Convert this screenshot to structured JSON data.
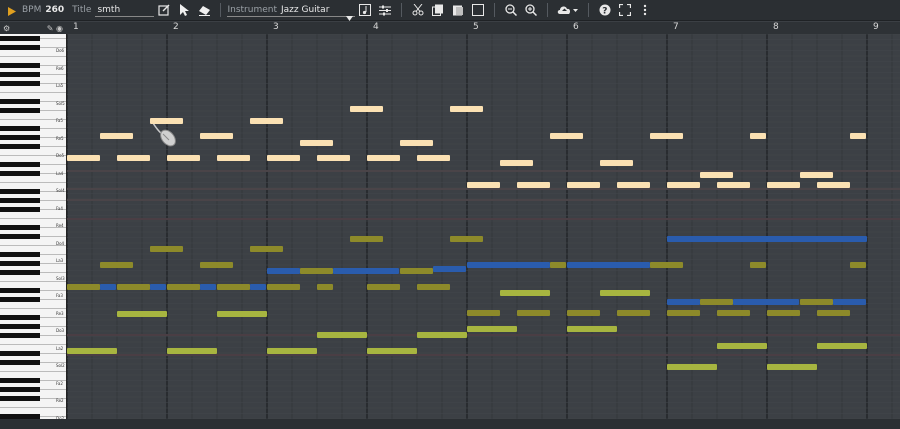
{
  "toolbar": {
    "bpm_label": "BPM",
    "bpm_value": "260",
    "title_label": "Title",
    "title_value": "smth",
    "instrument_label": "Instrument",
    "instrument_value": "Jazz Guitar",
    "icons": [
      "play-icon",
      "edit-icon",
      "pointer-icon",
      "eraser-icon",
      "dropdown-arrow-icon",
      "music-note-icon",
      "sliders-icon",
      "cut-icon",
      "copy-icon",
      "paste-icon",
      "square-icon",
      "zoom-out-icon",
      "zoom-in-icon",
      "upload-icon",
      "help-icon",
      "fullscreen-icon",
      "more-icon"
    ]
  },
  "bars": [
    "1",
    "2",
    "3",
    "4",
    "5",
    "6",
    "7",
    "8",
    "9"
  ],
  "keyboard_labels": [
    "Do6",
    "Re6",
    "La5",
    "Sol5",
    "Fa5",
    "Re5",
    "Do5",
    "La4",
    "Sol4",
    "Fa4",
    "Re4",
    "Do4",
    "La3",
    "Sol3",
    "Fa3",
    "Re3",
    "Do3",
    "La2",
    "Sol2",
    "Fa2",
    "Re2",
    "Do2"
  ],
  "colors": {
    "cream": "#fbe1b3",
    "olive": "#8d8a2a",
    "lime": "#a7b540",
    "blue": "#2a5cad",
    "background": "#3c4045",
    "toolbar": "#2b2f33"
  },
  "notes": {
    "cream": [
      {
        "row": "r1",
        "x": [
          0.0,
          1.04
        ]
      },
      {
        "row": "r2",
        "x": [
          0.7,
          1.05
        ]
      },
      {
        "row": "r3",
        "x": [
          1.55,
          1.9
        ]
      },
      {
        "row": "r2",
        "x": [
          2.1,
          2.45
        ]
      }
    ]
  }
}
